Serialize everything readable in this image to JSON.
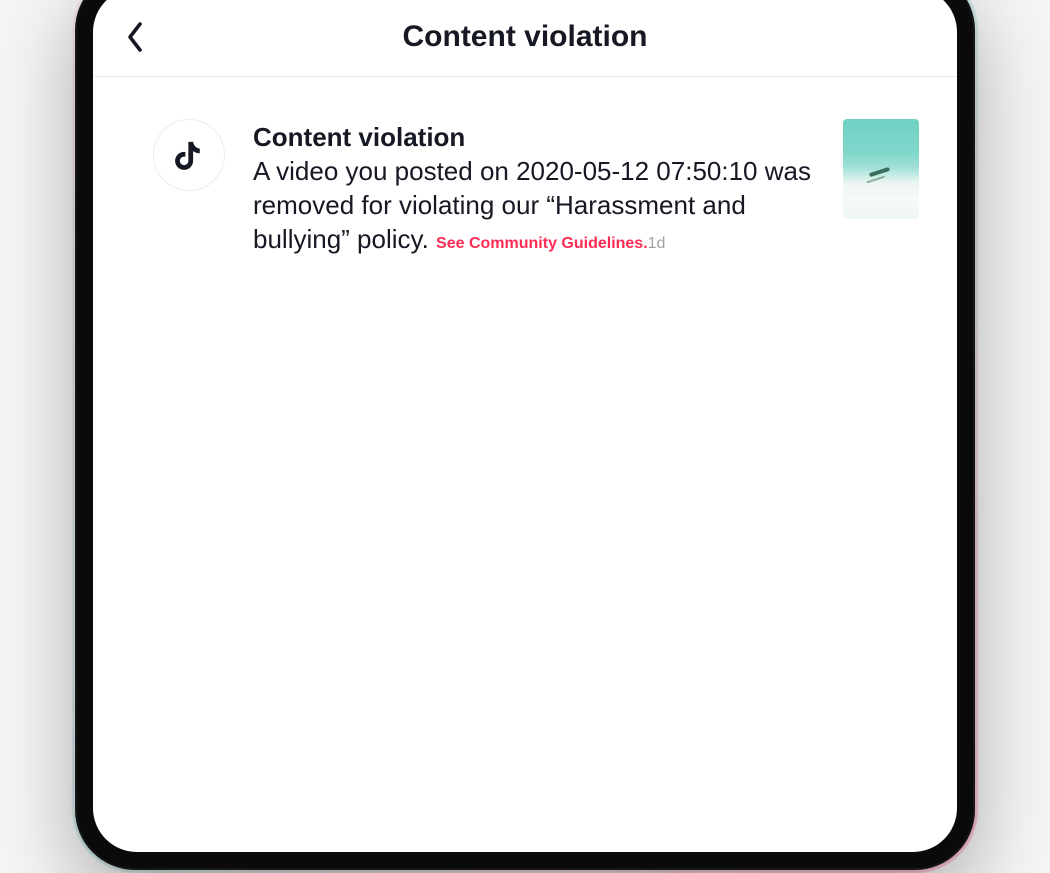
{
  "header": {
    "title": "Content violation"
  },
  "notification": {
    "title": "Content violation",
    "message": "A video you posted on 2020-05-12 07:50:10 was removed for violating our “Harassment and bullying” policy. ",
    "link_text": "See Community Guidelines.",
    "time": "1d"
  },
  "colors": {
    "accent_link": "#fe2c55",
    "text_primary": "#161823",
    "text_muted": "#a0a0a6"
  }
}
